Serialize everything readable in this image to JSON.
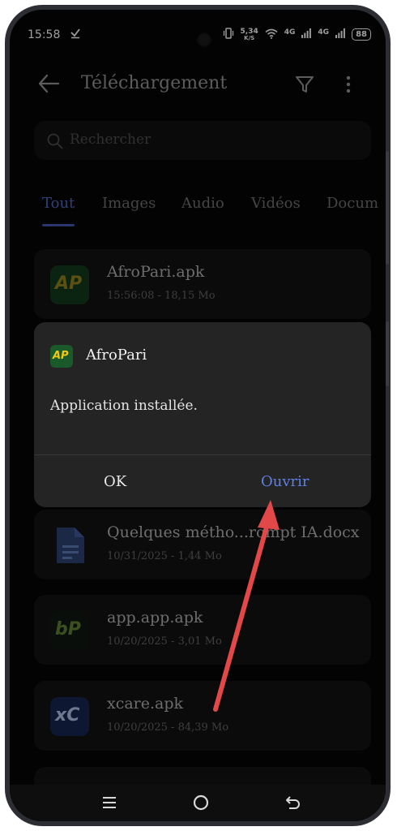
{
  "status_bar": {
    "time": "15:58",
    "download_icon": "check-download-icon",
    "net_speed_value": "5,34",
    "net_speed_unit": "K/S",
    "signal1_label": "4G",
    "signal2_label": "4G",
    "battery": "88"
  },
  "header": {
    "title": "Téléchargement",
    "back_icon": "back-arrow-icon",
    "filter_icon": "filter-icon",
    "more_icon": "more-vertical-icon"
  },
  "search": {
    "placeholder": "Rechercher"
  },
  "tabs": [
    {
      "label": "Tout",
      "active": true
    },
    {
      "label": "Images"
    },
    {
      "label": "Audio"
    },
    {
      "label": "Vidéos"
    },
    {
      "label": "Docum"
    }
  ],
  "files": [
    {
      "name": "AfroPari.apk",
      "meta": "15:56:08 - 18,15 Mo",
      "icon_text": "AP"
    },
    {
      "name": "Quelques métho...rompt IA.docx",
      "meta": "10/31/2025 - 1,44 Mo",
      "icon_text": ""
    },
    {
      "name": "app.app.apk",
      "meta": "10/20/2025 - 3,01 Mo",
      "icon_text": "bP"
    },
    {
      "name": "xcare.apk",
      "meta": "10/20/2025 - 84,39 Mo",
      "icon_text": "xC"
    }
  ],
  "dialog": {
    "app_name": "AfroPari",
    "icon_text": "AP",
    "message": "Application installée.",
    "ok_label": "OK",
    "open_label": "Ouvrir"
  },
  "colors": {
    "accent": "#5e7fe6",
    "annotation_arrow": "#e34848",
    "afropari_green": "#f0c814"
  }
}
